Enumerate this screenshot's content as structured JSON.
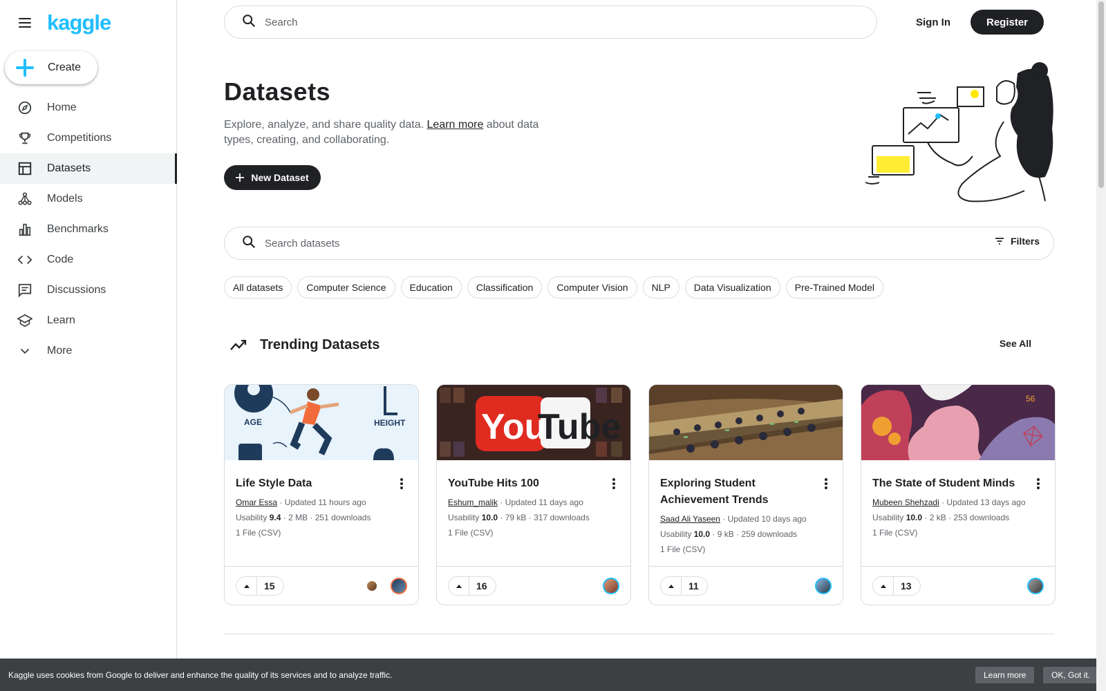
{
  "brand": {
    "logo": "kaggle",
    "accent": "#20beff"
  },
  "sidebar": {
    "create_label": "Create",
    "items": [
      {
        "label": "Home",
        "icon": "compass-icon"
      },
      {
        "label": "Competitions",
        "icon": "trophy-icon"
      },
      {
        "label": "Datasets",
        "icon": "table-icon",
        "active": true
      },
      {
        "label": "Models",
        "icon": "models-icon"
      },
      {
        "label": "Benchmarks",
        "icon": "bar-chart-icon"
      },
      {
        "label": "Code",
        "icon": "code-icon"
      },
      {
        "label": "Discussions",
        "icon": "comment-icon"
      },
      {
        "label": "Learn",
        "icon": "school-icon"
      },
      {
        "label": "More",
        "icon": "chevron-down-icon"
      }
    ]
  },
  "header": {
    "search_placeholder": "Search",
    "sign_in": "Sign In",
    "register": "Register"
  },
  "hero": {
    "title": "Datasets",
    "desc_before": "Explore, analyze, and share quality data. ",
    "desc_link": "Learn more",
    "desc_after": " about data types, creating, and collaborating.",
    "new_dataset": "New Dataset"
  },
  "dataset_search": {
    "placeholder": "Search datasets",
    "filters": "Filters"
  },
  "chips": [
    "All datasets",
    "Computer Science",
    "Education",
    "Classification",
    "Computer Vision",
    "NLP",
    "Data Visualization",
    "Pre-Trained Model"
  ],
  "trending": {
    "title": "Trending Datasets",
    "see_all": "See All",
    "cards": [
      {
        "title": "Life Style Data",
        "author": "Omar Essa",
        "updated": "Updated 11 hours ago",
        "usability": "9.4",
        "size": "2 MB",
        "downloads": "251 downloads",
        "files": "1 File (CSV)",
        "votes": "15"
      },
      {
        "title": "YouTube Hits 100",
        "author": "Eshum_malik",
        "updated": "Updated 11 days ago",
        "usability": "10.0",
        "size": "79 kB",
        "downloads": "317 downloads",
        "files": "1 File (CSV)",
        "votes": "16"
      },
      {
        "title": "Exploring Student Achievement Trends",
        "author": "Saad Ali Yaseen",
        "updated": "Updated 10 days ago",
        "usability": "10.0",
        "size": "9 kB",
        "downloads": "259 downloads",
        "files": "1 File (CSV)",
        "votes": "11"
      },
      {
        "title": "The State of Student Minds",
        "author": "Mubeen Shehzadi",
        "updated": "Updated 13 days ago",
        "usability": "10.0",
        "size": "2 kB",
        "downloads": "253 downloads",
        "files": "1 File (CSV)",
        "votes": "13"
      }
    ],
    "image_texts": {
      "age": "AGE",
      "height": "HEIGHT",
      "you": "You",
      "tube": "Tube",
      "badge": "56"
    }
  },
  "common": {
    "usability_label": "Usability",
    "sep": " · "
  },
  "cookie": {
    "text": "Kaggle uses cookies from Google to deliver and enhance the quality of its services and to analyze traffic.",
    "learn_more": "Learn more",
    "ok": "OK, Got it."
  }
}
